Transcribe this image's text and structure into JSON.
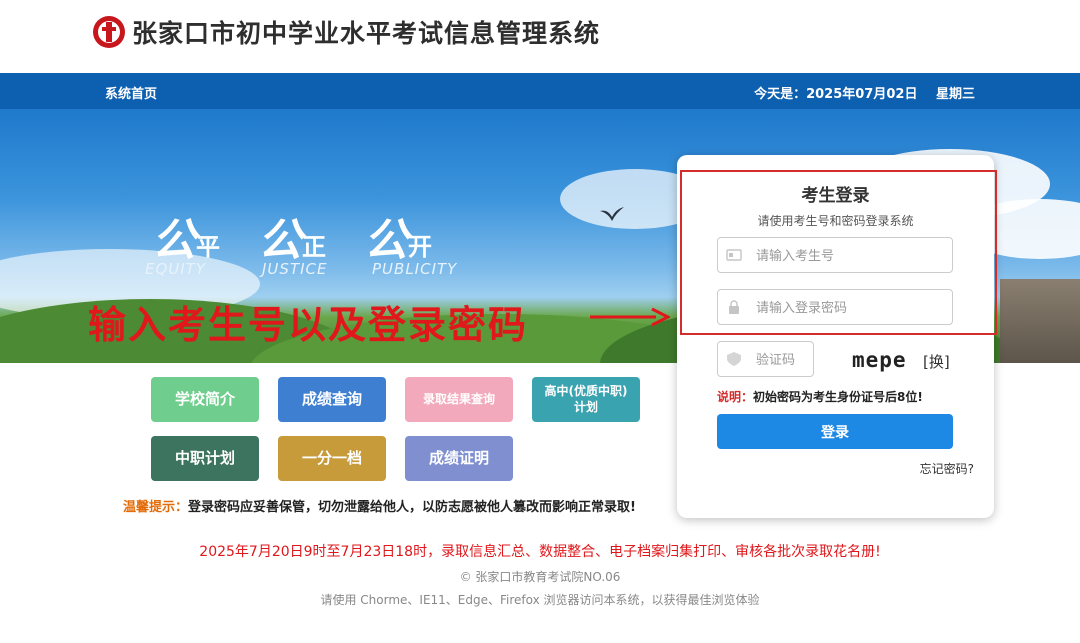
{
  "header": {
    "title": "张家口市初中学业水平考试信息管理系统",
    "logo_icon": "emblem-icon"
  },
  "nav": {
    "home": "系统首页",
    "date_label": "今天是：2025年07月02日",
    "weekday": "星期三"
  },
  "banner": {
    "motto": [
      {
        "big": "公",
        "small": "平",
        "en": "EQUITY"
      },
      {
        "big": "公",
        "small": "正",
        "en": "JUSTICE"
      },
      {
        "big": "公",
        "small": "开",
        "en": "PUBLICITY"
      }
    ],
    "instruction": "输入考生号以及登录密码"
  },
  "buttons": [
    {
      "label": "学校简介",
      "color": "#6fce8d"
    },
    {
      "label": "成绩查询",
      "color": "#3f7fd1"
    },
    {
      "label": "录取结果查询",
      "color": "#f2a9bb"
    },
    {
      "label": "高中(优质中职)\n计划",
      "color": "#3aa3b0"
    },
    {
      "label": "中职计划",
      "color": "#3c7460"
    },
    {
      "label": "一分一档",
      "color": "#c79b3a"
    },
    {
      "label": "成绩证明",
      "color": "#7f8fd0"
    }
  ],
  "warning": {
    "label": "温馨提示：",
    "text": "登录密码应妥善保管，切勿泄露给他人，以防志愿被他人篡改而影响正常录取!"
  },
  "login": {
    "title": "考生登录",
    "subtitle": "请使用考生号和密码登录系统",
    "username_placeholder": "请输入考生号",
    "password_placeholder": "请输入登录密码",
    "captcha_placeholder": "验证码",
    "captcha_text": "mepe",
    "captcha_change": "[换]",
    "note_label": "说明：",
    "note_text": "初始密码为考生身份证号后8位!",
    "submit": "登录",
    "forgot": "忘记密码?"
  },
  "footer": {
    "notice": "2025年7月20日9时至7月23日18时，录取信息汇总、数据整合、电子档案归集打印、审核各批次录取花名册!",
    "copyright": "© 张家口市教育考试院NO.06",
    "browser_tip": "请使用 Chorme、IE11、Edge、Firefox 浏览器访问本系统，以获得最佳浏览体验"
  },
  "colors": {
    "nav": "#0d5fb0",
    "accent_red": "#e0171b",
    "login_button": "#1e88e5"
  }
}
